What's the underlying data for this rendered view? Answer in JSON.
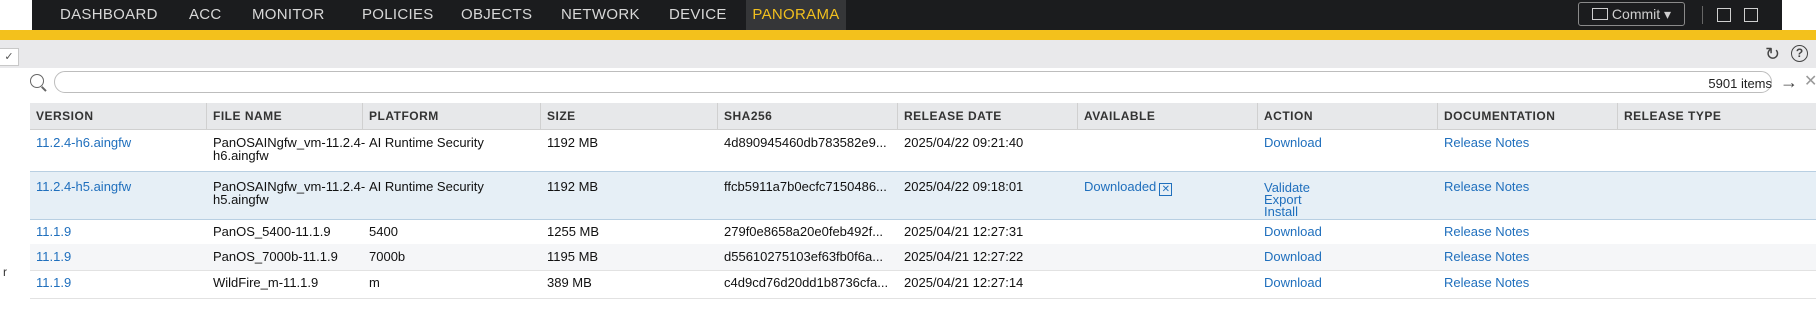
{
  "nav": {
    "tabs": [
      "DASHBOARD",
      "ACC",
      "MONITOR",
      "POLICIES",
      "OBJECTS",
      "NETWORK",
      "DEVICE",
      "PANORAMA"
    ],
    "active": "PANORAMA",
    "commit_label": "Commit"
  },
  "toolbar": {
    "stub_glyph": "✓",
    "refresh_glyph": "↻",
    "help_glyph": "?"
  },
  "search": {
    "value": "",
    "count": "5901 items",
    "go_glyph": "→",
    "clear_glyph": "✕"
  },
  "table": {
    "columns": [
      "VERSION",
      "FILE NAME",
      "PLATFORM",
      "SIZE",
      "SHA256",
      "RELEASE DATE",
      "AVAILABLE",
      "ACTION",
      "DOCUMENTATION",
      "RELEASE TYPE"
    ],
    "rows": [
      {
        "version": "11.2.4-h6.aingfw",
        "file_name_1": "PanOSAINgfw_vm-11.2.4-",
        "file_name_2": "h6.aingfw",
        "platform": "AI Runtime Security",
        "size": "1192 MB",
        "sha256": "4d890945460db783582e9...",
        "release_date": "2025/04/22 09:21:40",
        "available": "",
        "actions": [
          "Download"
        ],
        "documentation": "Release Notes",
        "release_type": ""
      },
      {
        "version": "11.2.4-h5.aingfw",
        "file_name_1": "PanOSAINgfw_vm-11.2.4-",
        "file_name_2": "h5.aingfw",
        "platform": "AI Runtime Security",
        "size": "1192 MB",
        "sha256": "ffcb5911a7b0ecfc7150486...",
        "release_date": "2025/04/22 09:18:01",
        "available": "Downloaded",
        "actions": [
          "Validate",
          "Export",
          "Install"
        ],
        "documentation": "Release Notes",
        "release_type": ""
      },
      {
        "version": "11.1.9",
        "file_name_1": "PanOS_5400-11.1.9",
        "file_name_2": "",
        "platform": "5400",
        "size": "1255 MB",
        "sha256": "279f0e8658a20e0feb492f...",
        "release_date": "2025/04/21 12:27:31",
        "available": "",
        "actions": [
          "Download"
        ],
        "documentation": "Release Notes",
        "release_type": ""
      },
      {
        "version": "11.1.9",
        "file_name_1": "PanOS_7000b-11.1.9",
        "file_name_2": "",
        "platform": "7000b",
        "size": "1195 MB",
        "sha256": "d55610275103ef63fb0f6a...",
        "release_date": "2025/04/21 12:27:22",
        "available": "",
        "actions": [
          "Download"
        ],
        "documentation": "Release Notes",
        "release_type": ""
      },
      {
        "version": "11.1.9",
        "file_name_1": "WildFire_m-11.1.9",
        "file_name_2": "",
        "platform": "m",
        "size": "389 MB",
        "sha256": "c4d9cd76d20dd1b8736cfa...",
        "release_date": "2025/04/21 12:27:14",
        "available": "",
        "actions": [
          "Download"
        ],
        "documentation": "Release Notes",
        "release_type": ""
      }
    ]
  },
  "left_edge_text": "r"
}
